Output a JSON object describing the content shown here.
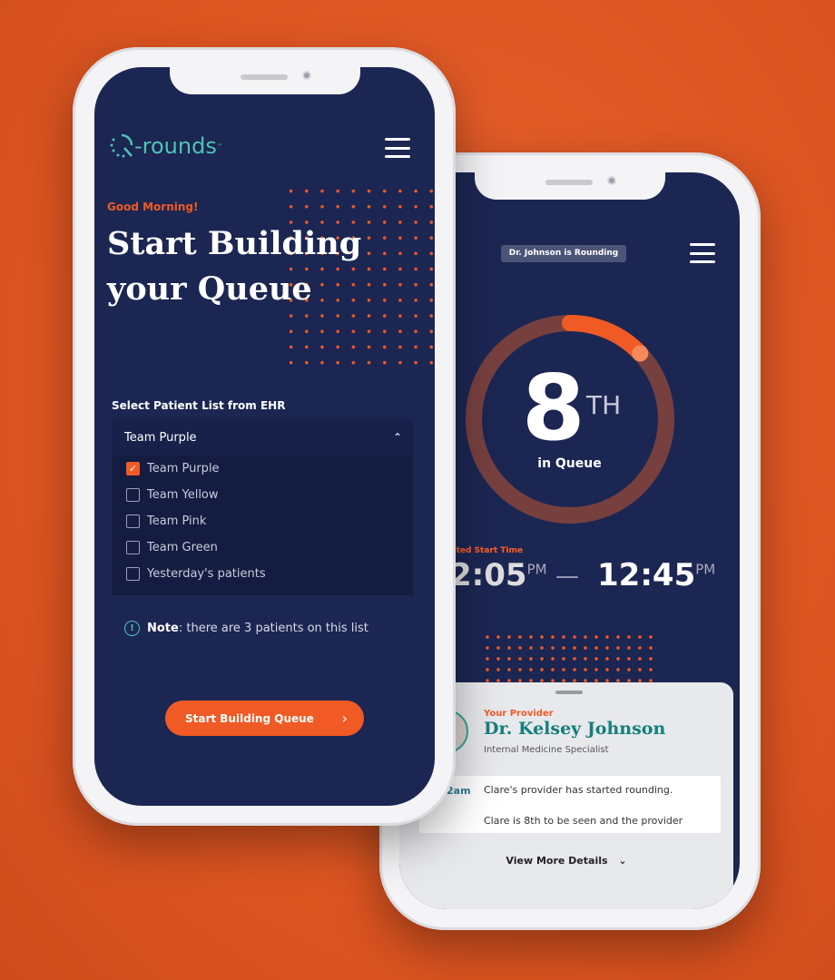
{
  "colors": {
    "accent": "#f05a24",
    "navy": "#1c2653",
    "teal": "#4fc3b4"
  },
  "back_phone": {
    "status_pill": "Dr. Johnson is Rounding",
    "queue": {
      "position": "8",
      "suffix": "TH",
      "label": "in Queue",
      "progress_fraction": 0.13
    },
    "start_time": {
      "label": "Expected Start Time",
      "visible_label": "cted Start Time",
      "from": "2:05",
      "from_ampm": "PM",
      "separator": "—",
      "to": "12:45",
      "to_ampm": "PM"
    },
    "provider": {
      "eyebrow": "Your Provider",
      "name": "Dr. Kelsey Johnson",
      "specialty": "Internal Medicine Specialist"
    },
    "updates": {
      "time_fragment": "2am",
      "lines": [
        "Clare's provider has started rounding.",
        "Clare is 8th to be seen and the provider"
      ]
    },
    "view_more": "View More Details"
  },
  "front_phone": {
    "logo": "Q-rounds",
    "greeting": "Good Morning!",
    "title_line1": "Start Building",
    "title_line2": "your Queue",
    "select_label": "Select Patient List from EHR",
    "dropdown": {
      "selected": "Team Purple",
      "options": [
        {
          "label": "Team Purple",
          "checked": true
        },
        {
          "label": "Team Yellow",
          "checked": false
        },
        {
          "label": "Team Pink",
          "checked": false
        },
        {
          "label": "Team Green",
          "checked": false
        },
        {
          "label": "Yesterday's patients",
          "checked": false
        }
      ]
    },
    "note_bold": "Note",
    "note_text": ": there are 3 patients on this list",
    "cta": "Start Building Queue"
  }
}
